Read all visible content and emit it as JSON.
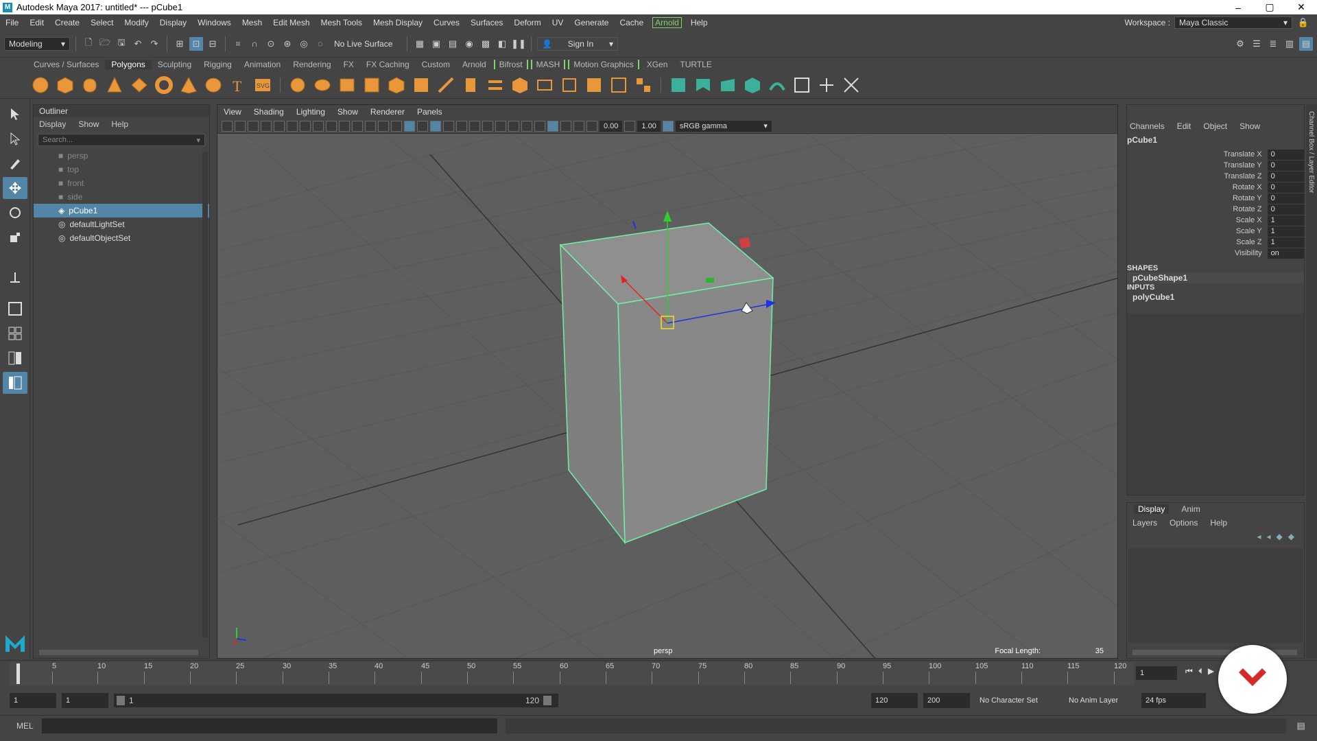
{
  "window": {
    "title": "Autodesk Maya 2017: untitled*   ---   pCube1",
    "min": "–",
    "max": "▢",
    "close": "✕",
    "logo": "M"
  },
  "menu": [
    "File",
    "Edit",
    "Create",
    "Select",
    "Modify",
    "Display",
    "Windows",
    "Mesh",
    "Edit Mesh",
    "Mesh Tools",
    "Mesh Display",
    "Curves",
    "Surfaces",
    "Deform",
    "UV",
    "Generate",
    "Cache",
    "Arnold",
    "Help"
  ],
  "workspace": {
    "label": "Workspace :",
    "value": "Maya Classic"
  },
  "statusline": {
    "mode": "Modeling",
    "live_surface": "No Live Surface",
    "sign_in": "Sign In"
  },
  "shelf_tabs": [
    "Curves / Surfaces",
    "Polygons",
    "Sculpting",
    "Rigging",
    "Animation",
    "Rendering",
    "FX",
    "FX Caching",
    "Custom",
    "Arnold",
    "Bifrost",
    "MASH",
    "Motion Graphics",
    "XGen",
    "TURTLE"
  ],
  "shelf_active": "Polygons",
  "outliner": {
    "title": "Outliner",
    "menu": [
      "Display",
      "Show",
      "Help"
    ],
    "search_placeholder": "Search...",
    "items": [
      {
        "label": "persp",
        "dim": true
      },
      {
        "label": "top",
        "dim": true
      },
      {
        "label": "front",
        "dim": true
      },
      {
        "label": "side",
        "dim": true
      },
      {
        "label": "pCube1",
        "selected": true
      },
      {
        "label": "defaultLightSet"
      },
      {
        "label": "defaultObjectSet"
      }
    ]
  },
  "viewport": {
    "menu": [
      "View",
      "Shading",
      "Lighting",
      "Show",
      "Renderer",
      "Panels"
    ],
    "num1": "0.00",
    "num2": "1.00",
    "color_space": "sRGB gamma",
    "camera": "persp",
    "focal_label": "Focal Length:",
    "focal_value": "35"
  },
  "channels": {
    "menu": [
      "Channels",
      "Edit",
      "Object",
      "Show"
    ],
    "object": "pCube1",
    "attrs": [
      {
        "label": "Translate X",
        "value": "0"
      },
      {
        "label": "Translate Y",
        "value": "0"
      },
      {
        "label": "Translate Z",
        "value": "0"
      },
      {
        "label": "Rotate X",
        "value": "0"
      },
      {
        "label": "Rotate Y",
        "value": "0"
      },
      {
        "label": "Rotate Z",
        "value": "0"
      },
      {
        "label": "Scale X",
        "value": "1"
      },
      {
        "label": "Scale Y",
        "value": "1"
      },
      {
        "label": "Scale Z",
        "value": "1"
      },
      {
        "label": "Visibility",
        "value": "on"
      }
    ],
    "shapes_head": "SHAPES",
    "shape": "pCubeShape1",
    "inputs_head": "INPUTS",
    "input": "polyCube1"
  },
  "layers": {
    "tabs": [
      "Display",
      "Anim"
    ],
    "menu": [
      "Layers",
      "Options",
      "Help"
    ]
  },
  "side_strip": "Channel Box / Layer Editor",
  "timeline": {
    "ticks": [
      "5",
      "10",
      "15",
      "20",
      "25",
      "30",
      "35",
      "40",
      "45",
      "50",
      "55",
      "60",
      "65",
      "70",
      "75",
      "80",
      "85",
      "90",
      "95",
      "100",
      "105",
      "110",
      "115",
      "120"
    ],
    "current": "1"
  },
  "range": {
    "start": "1",
    "start2": "1",
    "slider_start": "1",
    "slider_end": "120",
    "end": "120",
    "end2": "200",
    "character_set": "No Character Set",
    "anim_layer": "No Anim Layer",
    "fps": "24 fps"
  },
  "cmd": {
    "label": "MEL"
  }
}
